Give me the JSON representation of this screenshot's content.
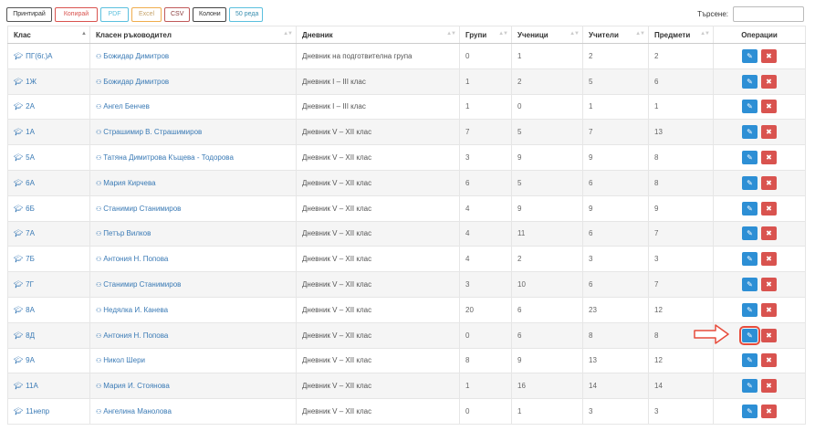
{
  "toolbar": {
    "print": "Принтирай",
    "copy": "Копирай",
    "pdf": "PDF",
    "excel": "Excel",
    "csv": "CSV",
    "columns": "Колони",
    "rows": "50 реда"
  },
  "search": {
    "label": "Търсене:",
    "value": ""
  },
  "columns": {
    "class": "Клас",
    "teacher": "Класен ръководител",
    "diary": "Дневник",
    "groups": "Групи",
    "students": "Ученици",
    "teachers": "Учители",
    "subjects": "Предмети",
    "operations": "Операции"
  },
  "icons": {
    "class": "graduation-cap-icon",
    "teacher": "teacher-icon",
    "edit": "edit-icon",
    "delete": "delete-icon",
    "pointer": "arrow-right-icon"
  },
  "colors": {
    "edit": "#2d8fd5",
    "delete": "#d9534f",
    "link": "#3a7ab5",
    "highlight": "#e74c3c"
  },
  "rows": [
    {
      "class": "ПГ(6г.)А",
      "teacher": "Божидар Димитров",
      "diary": "Дневник на подготвителна група",
      "groups": "0",
      "students": "1",
      "teachers": "2",
      "subjects": "2"
    },
    {
      "class": "1Ж",
      "teacher": "Божидар Димитров",
      "diary": "Дневник I – III клас",
      "groups": "1",
      "students": "2",
      "teachers": "5",
      "subjects": "6"
    },
    {
      "class": "2А",
      "teacher": "Ангел Бенчев",
      "diary": "Дневник I – III клас",
      "groups": "1",
      "students": "0",
      "teachers": "1",
      "subjects": "1"
    },
    {
      "class": "1А",
      "teacher": "Страшимир В. Страшимиров",
      "diary": "Дневник V – XII клас",
      "groups": "7",
      "students": "5",
      "teachers": "7",
      "subjects": "13"
    },
    {
      "class": "5А",
      "teacher": "Татяна Димитрова Къщева - Тодорова",
      "diary": "Дневник V – XII клас",
      "groups": "3",
      "students": "9",
      "teachers": "9",
      "subjects": "8"
    },
    {
      "class": "6А",
      "teacher": "Мария Кирчева",
      "diary": "Дневник V – XII клас",
      "groups": "6",
      "students": "5",
      "teachers": "6",
      "subjects": "8"
    },
    {
      "class": "6Б",
      "teacher": "Станимир Станимиров",
      "diary": "Дневник V – XII клас",
      "groups": "4",
      "students": "9",
      "teachers": "9",
      "subjects": "9"
    },
    {
      "class": "7А",
      "teacher": "Петър Вилков",
      "diary": "Дневник V – XII клас",
      "groups": "4",
      "students": "11",
      "teachers": "6",
      "subjects": "7"
    },
    {
      "class": "7Б",
      "teacher": "Антония Н. Попова",
      "diary": "Дневник V – XII клас",
      "groups": "4",
      "students": "2",
      "teachers": "3",
      "subjects": "3"
    },
    {
      "class": "7Г",
      "teacher": "Станимир Станимиров",
      "diary": "Дневник V – XII клас",
      "groups": "3",
      "students": "10",
      "teachers": "6",
      "subjects": "7"
    },
    {
      "class": "8А",
      "teacher": "Недялка И. Канева",
      "diary": "Дневник V – XII клас",
      "groups": "20",
      "students": "6",
      "teachers": "23",
      "subjects": "12"
    },
    {
      "class": "8Д",
      "teacher": "Антония Н. Попова",
      "diary": "Дневник V – XII клас",
      "groups": "0",
      "students": "6",
      "teachers": "8",
      "subjects": "8",
      "highlighted": true
    },
    {
      "class": "9А",
      "teacher": "Никол Шери",
      "diary": "Дневник V – XII клас",
      "groups": "8",
      "students": "9",
      "teachers": "13",
      "subjects": "12"
    },
    {
      "class": "11А",
      "teacher": "Мария И. Стоянова",
      "diary": "Дневник V – XII клас",
      "groups": "1",
      "students": "16",
      "teachers": "14",
      "subjects": "14"
    },
    {
      "class": "11непр",
      "teacher": "Ангелина Манолова",
      "diary": "Дневник V – XII клас",
      "groups": "0",
      "students": "1",
      "teachers": "3",
      "subjects": "3"
    }
  ]
}
